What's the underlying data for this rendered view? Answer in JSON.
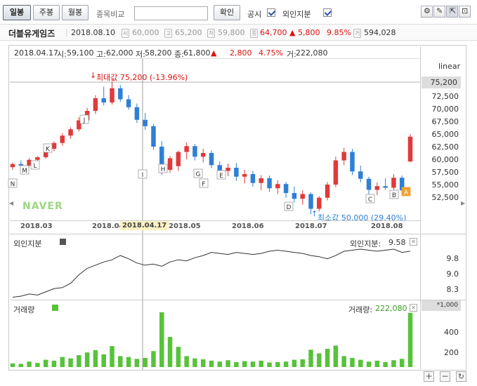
{
  "toolbar": {
    "period_buttons": [
      "일봉",
      "주봉",
      "월봉"
    ],
    "compare_label": "종목비교",
    "compare_input": "",
    "confirm_label": "확인",
    "disclosure_label": "공시",
    "foreign_label": "외인지분"
  },
  "stock": {
    "name": "더블유게임즈",
    "date": "2018.08.10",
    "open": "60,000",
    "high": "65,200",
    "low": "59,800",
    "close": "64,700",
    "change": "▲ 5,800",
    "change_pct": "9.85%",
    "volume": "594,028"
  },
  "cursor_info": {
    "date": "2018.04.17",
    "open_label": "시:",
    "open": "59,100",
    "high_label": "고:",
    "high": "62,000",
    "low_label": "저:",
    "low": "58,200",
    "close_label": "종:",
    "close": "61,800",
    "arrow": "▲",
    "change": "2,800",
    "change_pct": "4.75%",
    "volume_label": "거:",
    "volume": "222,080"
  },
  "main_chart": {
    "scale_label": "linear",
    "max_annotation": "최대값 75,200 (-13.96%)",
    "min_annotation": "최소값 50,000 (29.40%)",
    "current_price_label": "75,200",
    "watermark": "NAVER",
    "x_ticks": [
      "2018.03",
      "2018.04",
      "2018.05",
      "2018.06",
      "2018.07",
      "2018.08"
    ],
    "cursor_date_label": "2018.04.17",
    "y_ticks": [
      "72,500",
      "70,000",
      "67,500",
      "65,000",
      "62,500",
      "60,000",
      "57,500",
      "55,000",
      "52,500"
    ],
    "event_markers": [
      "N",
      "M",
      "L",
      "K",
      "J",
      "I",
      "H",
      "G",
      "F",
      "E",
      "D",
      "C",
      "B",
      "A"
    ]
  },
  "foreign_panel": {
    "title": "외인지분",
    "value_label": "외인지분:",
    "value": "9.58",
    "y_ticks": [
      "9.8",
      "9.0",
      "8.3"
    ]
  },
  "volume_panel": {
    "title": "거래량",
    "value_label": "거래량:",
    "value": "222,080",
    "unit_label": "*1,000",
    "y_ticks": [
      "400",
      "200"
    ]
  },
  "colors": {
    "up": "#e03a3a",
    "down": "#2e7fd6",
    "volume": "#57c23a",
    "line": "#333333"
  },
  "chart_data": [
    {
      "type": "candlestick",
      "title": "",
      "x_range": [
        "2018.02.27",
        "2018.08.10"
      ],
      "ylim": [
        50000,
        76000
      ],
      "series": [
        {
          "values": [
            [
              58900,
              59800,
              58400,
              59500
            ],
            [
              59500,
              60200,
              58800,
              59200
            ],
            [
              59200,
              60600,
              59000,
              60300
            ],
            [
              60300,
              61000,
              59700,
              60800
            ],
            [
              60800,
              62800,
              60500,
              62400
            ],
            [
              62400,
              63800,
              61900,
              63500
            ],
            [
              63500,
              65400,
              63000,
              64900
            ],
            [
              64900,
              66500,
              64300,
              66100
            ],
            [
              66100,
              68400,
              65700,
              67800
            ],
            [
              67800,
              70200,
              67300,
              69600
            ],
            [
              69600,
              72600,
              69000,
              72000
            ],
            [
              72000,
              74200,
              70600,
              71200
            ],
            [
              71200,
              75200,
              70800,
              73900
            ],
            [
              73900,
              74500,
              71300,
              71800
            ],
            [
              71800,
              72600,
              69800,
              70300
            ],
            [
              70300,
              71000,
              67300,
              67900
            ],
            [
              67900,
              69200,
              66000,
              66700
            ],
            [
              66700,
              67100,
              62200,
              62800
            ],
            [
              62800,
              63900,
              57500,
              58400
            ],
            [
              58400,
              61000,
              57800,
              60600
            ],
            [
              59100,
              62000,
              58200,
              61800
            ],
            [
              61800,
              63600,
              60400,
              62900
            ],
            [
              62900,
              63300,
              60200,
              60900
            ],
            [
              60900,
              62400,
              59800,
              61600
            ],
            [
              61600,
              62100,
              58700,
              59300
            ],
            [
              59300,
              60000,
              57600,
              58200
            ],
            [
              58200,
              59600,
              57200,
              58800
            ],
            [
              58800,
              59700,
              56300,
              57100
            ],
            [
              57100,
              58400,
              55800,
              57600
            ],
            [
              57600,
              58200,
              55200,
              55900
            ],
            [
              55900,
              57400,
              54500,
              56800
            ],
            [
              56800,
              57300,
              54200,
              54900
            ],
            [
              54900,
              56400,
              53800,
              55700
            ],
            [
              55700,
              56100,
              53100,
              54000
            ],
            [
              54000,
              55200,
              52200,
              52900
            ],
            [
              52900,
              54500,
              51800,
              53800
            ],
            [
              53800,
              54100,
              50000,
              51000
            ],
            [
              51000,
              53400,
              50500,
              53100
            ],
            [
              53100,
              56100,
              52600,
              55600
            ],
            [
              55600,
              60900,
              55100,
              60200
            ],
            [
              60200,
              62600,
              59300,
              61800
            ],
            [
              61800,
              62400,
              57400,
              58100
            ],
            [
              58100,
              59200,
              56000,
              56700
            ],
            [
              56700,
              57100,
              53800,
              54600
            ],
            [
              54600,
              56000,
              53600,
              55300
            ],
            [
              55300,
              56800,
              54600,
              55000
            ],
            [
              55000,
              57600,
              54400,
              56900
            ],
            [
              56900,
              57300,
              53900,
              54500
            ],
            [
              60000,
              65200,
              59800,
              64700
            ]
          ]
        }
      ]
    },
    {
      "type": "line",
      "title": "외인지분",
      "ylim": [
        7.9,
        10.2
      ],
      "series": [
        {
          "name": "외인지분",
          "values": [
            7.95,
            8.0,
            8.1,
            8.05,
            8.2,
            8.35,
            8.4,
            8.6,
            9.0,
            9.3,
            9.45,
            9.6,
            9.7,
            9.9,
            9.75,
            9.55,
            9.45,
            9.5,
            9.4,
            9.6,
            9.7,
            9.65,
            9.8,
            9.9,
            10.05,
            10.0,
            9.95,
            10.05,
            10.0,
            9.95,
            10.0,
            10.1,
            10.15,
            10.1,
            10.05,
            10.0,
            9.9,
            9.85,
            9.75,
            9.9,
            10.1,
            10.15,
            10.2,
            10.15,
            10.1,
            10.15,
            10.2,
            10.05,
            10.1
          ]
        }
      ]
    },
    {
      "type": "bar",
      "title": "거래량",
      "ylim": [
        0,
        600
      ],
      "series": [
        {
          "name": "거래량",
          "values": [
            40,
            35,
            60,
            45,
            80,
            70,
            110,
            95,
            130,
            160,
            185,
            140,
            230,
            120,
            110,
            90,
            100,
            175,
            620,
            330,
            222,
            120,
            95,
            85,
            70,
            60,
            75,
            55,
            65,
            60,
            70,
            50,
            55,
            60,
            80,
            85,
            190,
            150,
            200,
            235,
            120,
            100,
            80,
            60,
            70,
            55,
            75,
            90,
            594
          ]
        }
      ]
    }
  ]
}
